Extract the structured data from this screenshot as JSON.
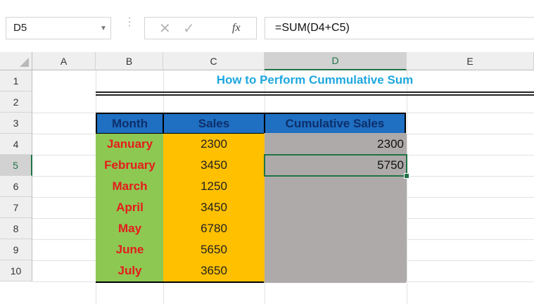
{
  "formula_bar": {
    "name_box": "D5",
    "cancel_icon": "✕",
    "enter_icon": "✓",
    "fx_label": "fx",
    "formula": "=SUM(D4+C5)"
  },
  "columns": [
    "A",
    "B",
    "C",
    "D",
    "E"
  ],
  "rows": [
    "1",
    "2",
    "3",
    "4",
    "5",
    "6",
    "7",
    "8",
    "9",
    "10"
  ],
  "selected_cell": {
    "column": "D",
    "row": "5"
  },
  "title": "How to Perform Cummulative Sum",
  "table": {
    "headers": {
      "month": "Month",
      "sales": "Sales",
      "cumulative": "Cumulative Sales"
    },
    "data": [
      {
        "month": "January",
        "sales": "2300",
        "cumulative": "2300"
      },
      {
        "month": "February",
        "sales": "3450",
        "cumulative": "5750"
      },
      {
        "month": "March",
        "sales": "1250",
        "cumulative": ""
      },
      {
        "month": "April",
        "sales": "3450",
        "cumulative": ""
      },
      {
        "month": "May",
        "sales": "6780",
        "cumulative": ""
      },
      {
        "month": "June",
        "sales": "5650",
        "cumulative": ""
      },
      {
        "month": "July",
        "sales": "3650",
        "cumulative": ""
      }
    ]
  },
  "colors": {
    "header_fill": "#1f6fc2",
    "month_fill": "#8dc853",
    "month_text": "#e51c1c",
    "sales_fill": "#ffc000",
    "cumulative_fill": "#aeaaaa",
    "title_text": "#1ea7df",
    "selection": "#217346"
  }
}
